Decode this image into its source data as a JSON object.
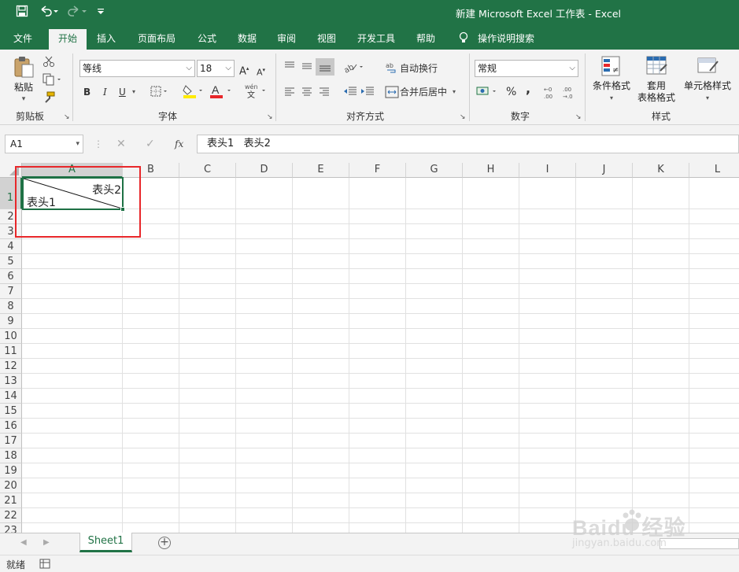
{
  "window": {
    "title": "新建 Microsoft Excel 工作表  -  Excel"
  },
  "qat": {
    "save_icon": "save-icon",
    "undo_icon": "undo-icon",
    "redo_icon": "redo-icon",
    "customize_icon": "customize-icon"
  },
  "tabs": [
    {
      "label": "文件"
    },
    {
      "label": "开始"
    },
    {
      "label": "插入"
    },
    {
      "label": "页面布局"
    },
    {
      "label": "公式"
    },
    {
      "label": "数据"
    },
    {
      "label": "审阅"
    },
    {
      "label": "视图"
    },
    {
      "label": "开发工具"
    },
    {
      "label": "帮助"
    },
    {
      "label": "操作说明搜索"
    }
  ],
  "ribbon": {
    "clipboard": {
      "paste": "粘贴",
      "label": "剪贴板"
    },
    "font": {
      "name": "等线",
      "size": "18",
      "bold": "B",
      "italic": "I",
      "underline": "U",
      "label": "字体"
    },
    "alignment": {
      "wrap": "自动换行",
      "merge": "合并后居中",
      "label": "对齐方式"
    },
    "number": {
      "format": "常规",
      "percent": "%",
      "comma": ",",
      "label": "数字"
    },
    "styles": {
      "conditional": "条件格式",
      "table_line1": "套用",
      "table_line2": "表格格式",
      "cell_styles": "单元格样式",
      "label": "样式"
    }
  },
  "formula_bar": {
    "name_box": "A1",
    "fx": "fx",
    "content": "表头1   表头2"
  },
  "columns": [
    "A",
    "B",
    "C",
    "D",
    "E",
    "F",
    "G",
    "H",
    "I",
    "J",
    "K",
    "L"
  ],
  "rows": [
    "1",
    "2",
    "3",
    "4",
    "5",
    "6",
    "7",
    "8",
    "9",
    "10",
    "11",
    "12",
    "13",
    "14",
    "15",
    "16",
    "17",
    "18",
    "19",
    "20",
    "21",
    "22",
    "23"
  ],
  "cell_a1": {
    "top_right": "表头2",
    "bottom_left": "表头1"
  },
  "sheets": [
    {
      "name": "Sheet1"
    }
  ],
  "status": {
    "ready": "就绪"
  },
  "watermark": {
    "brand": "Baidu 经验",
    "url": "jingyan.baidu.com"
  },
  "colors": {
    "excel_green": "#217346",
    "highlight_red": "#e8272a",
    "selection_green": "#1e7145"
  }
}
